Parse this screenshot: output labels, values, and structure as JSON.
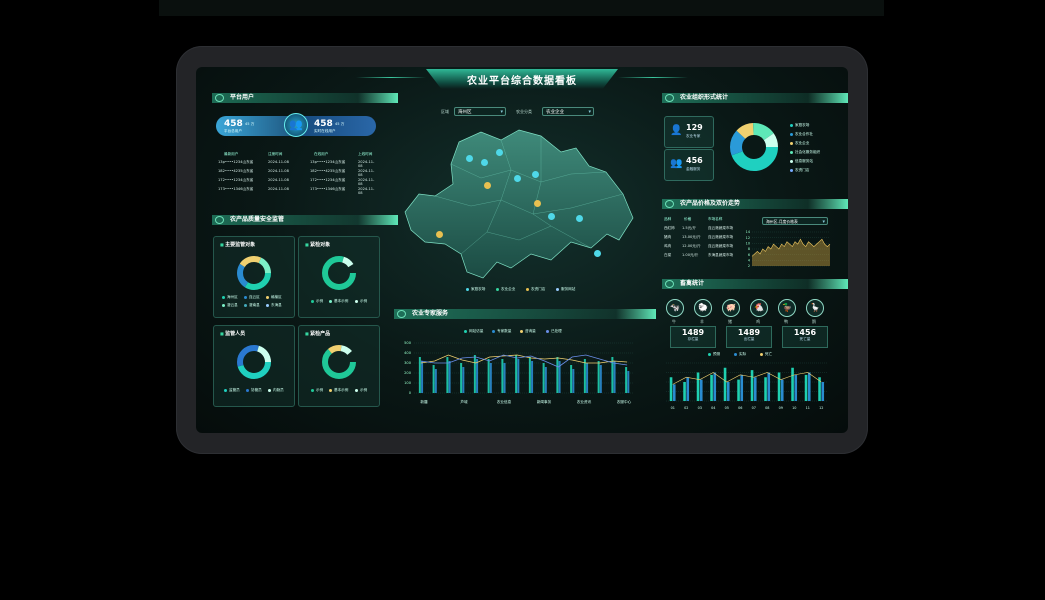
{
  "dashboard": {
    "title": "农业平台综合数据看板",
    "filters": {
      "region_label": "区域",
      "region_value": "海州区",
      "type_label": "农业分类",
      "type_value": "农业企业"
    },
    "map_legend": [
      "家庭农场",
      "农业企业",
      "农资门店",
      "服务网站"
    ]
  },
  "left": {
    "users_title": "平台用户",
    "total_users": {
      "value": "458",
      "unit": "45 万",
      "label": "平台总用户"
    },
    "online_users": {
      "value": "458",
      "unit": "45 万",
      "label": "实时在线用户"
    },
    "table_headers": [
      "最新用户",
      "注册时间",
      "在线用户",
      "上线时间"
    ],
    "table_rows": [
      [
        "13p••••1234山东省",
        "2024-11-08",
        "13p••••1234山东省",
        "2024-11-08"
      ],
      [
        "182••••4235山东省",
        "2024-11-08",
        "182••••4235山东省",
        "2024-11-08"
      ],
      [
        "172••••1234山东省",
        "2024-11-08",
        "172••••1234山东省",
        "2024-11-08"
      ],
      [
        "173••••1346山东省",
        "2024-11-08",
        "173••••1346山东省",
        "2024-11-08"
      ]
    ],
    "safety_title": "农产品质量安全监管",
    "panels": [
      {
        "title": "主要监管对象",
        "legend": [
          "海州区",
          "连云区",
          "赣榆区",
          "灌云县",
          "灌南县",
          "东海县"
        ]
      },
      {
        "title": "紧检对象",
        "legend": [
          "示例",
          "基本示例",
          "示例"
        ]
      },
      {
        "title": "监管人员",
        "legend": [
          "监管员",
          "协管员",
          "内勤员"
        ]
      },
      {
        "title": "紧检产品",
        "legend": [
          "示例",
          "基本示例",
          "示例"
        ]
      }
    ]
  },
  "middle": {
    "expert_title": "农业专家服务",
    "legend": [
      "网站访量",
      "专家数量",
      "咨询量",
      "已处理"
    ],
    "y_ticks": [
      "500",
      "400",
      "300",
      "200",
      "100",
      "0"
    ],
    "x_labels": [
      "新疆",
      "芦城",
      "农业信息",
      "新闻事务",
      "农业资讯",
      "农服中心"
    ]
  },
  "right": {
    "org_title": "农业组织形式统计",
    "experts_count": "129",
    "experts_label": "农业专家",
    "service_count": "456",
    "service_label": "金融服务",
    "org_legend": [
      "家庭农场",
      "农业合作社",
      "农业企业",
      "社会化服务组织",
      "信息服务站",
      "农资门店"
    ],
    "price_title": "农产品价格及双价走势",
    "price_headers": [
      "品种",
      "价格",
      "市场名称"
    ],
    "price_rows": [
      [
        "西红柿",
        "1.5元/斤",
        "连云港蔬菜市场"
      ],
      [
        "猪肉",
        "13.00元/斤",
        "连云港蔬菜市场"
      ],
      [
        "鸡肉",
        "12.00元/斤",
        "连云港蔬菜市场"
      ],
      [
        "白菜",
        "1.00元/斤",
        "东海县蔬菜市场"
      ]
    ],
    "price_select": "海州区-月度价格表",
    "price_y": [
      "14",
      "12",
      "10",
      "8",
      "6",
      "4",
      "2"
    ],
    "livestock_title": "畜禽统计",
    "animals": [
      "牛",
      "羊",
      "猪",
      "鸡",
      "鸭",
      "鹅"
    ],
    "livestock_stats": [
      {
        "value": "1489",
        "label": "存栏量"
      },
      {
        "value": "1489",
        "label": "出栏量"
      },
      {
        "value": "1456",
        "label": "死亡量"
      }
    ],
    "bar_legend": [
      "预测",
      "实际",
      "死亡"
    ],
    "bar_x": [
      "01",
      "02",
      "03",
      "04",
      "05",
      "06",
      "07",
      "08",
      "09",
      "10",
      "11",
      "12"
    ]
  },
  "chart_data": [
    {
      "type": "bar",
      "title": "农业专家服务",
      "categories": [
        "新疆",
        "",
        "芦城",
        "",
        "",
        "农业信息",
        "",
        "",
        "新闻事务",
        "",
        "",
        "农业资讯",
        "",
        "",
        "农服中心",
        ""
      ],
      "series": [
        {
          "name": "网站访量",
          "values": [
            360,
            280,
            360,
            300,
            380,
            340,
            340,
            380,
            360,
            300,
            360,
            280,
            340,
            320,
            360,
            260
          ]
        },
        {
          "name": "专家数量",
          "values": [
            320,
            240,
            320,
            260,
            340,
            300,
            300,
            340,
            320,
            260,
            320,
            240,
            300,
            280,
            320,
            220
          ]
        },
        {
          "name": "咨询量",
          "values": [
            300,
            320,
            380,
            330,
            300,
            360,
            370,
            380,
            350,
            340,
            350,
            330,
            300,
            300,
            320,
            310
          ]
        },
        {
          "name": "已处理",
          "values": [
            320,
            300,
            300,
            350,
            360,
            320,
            380,
            350,
            370,
            320,
            260,
            360,
            380,
            340,
            300,
            280
          ]
        }
      ],
      "ylim": [
        0,
        500
      ]
    },
    {
      "type": "area",
      "title": "农产品价格及双价走势",
      "values": [
        4,
        5,
        6,
        5,
        7,
        6,
        8,
        7,
        9,
        8,
        7,
        9,
        8,
        10,
        9,
        8,
        10,
        9,
        11,
        9,
        8,
        10,
        9,
        8,
        9,
        10,
        11,
        9,
        8,
        9
      ],
      "ylim": [
        0,
        14
      ]
    },
    {
      "type": "bar",
      "title": "畜禽统计",
      "categories": [
        "01",
        "02",
        "03",
        "04",
        "05",
        "06",
        "07",
        "08",
        "09",
        "10",
        "11",
        "12"
      ],
      "series": [
        {
          "name": "预测",
          "values": [
            50,
            40,
            60,
            55,
            70,
            45,
            65,
            50,
            60,
            70,
            55,
            50
          ]
        },
        {
          "name": "实际",
          "values": [
            35,
            50,
            45,
            60,
            40,
            55,
            50,
            60,
            45,
            55,
            60,
            40
          ]
        }
      ]
    }
  ]
}
